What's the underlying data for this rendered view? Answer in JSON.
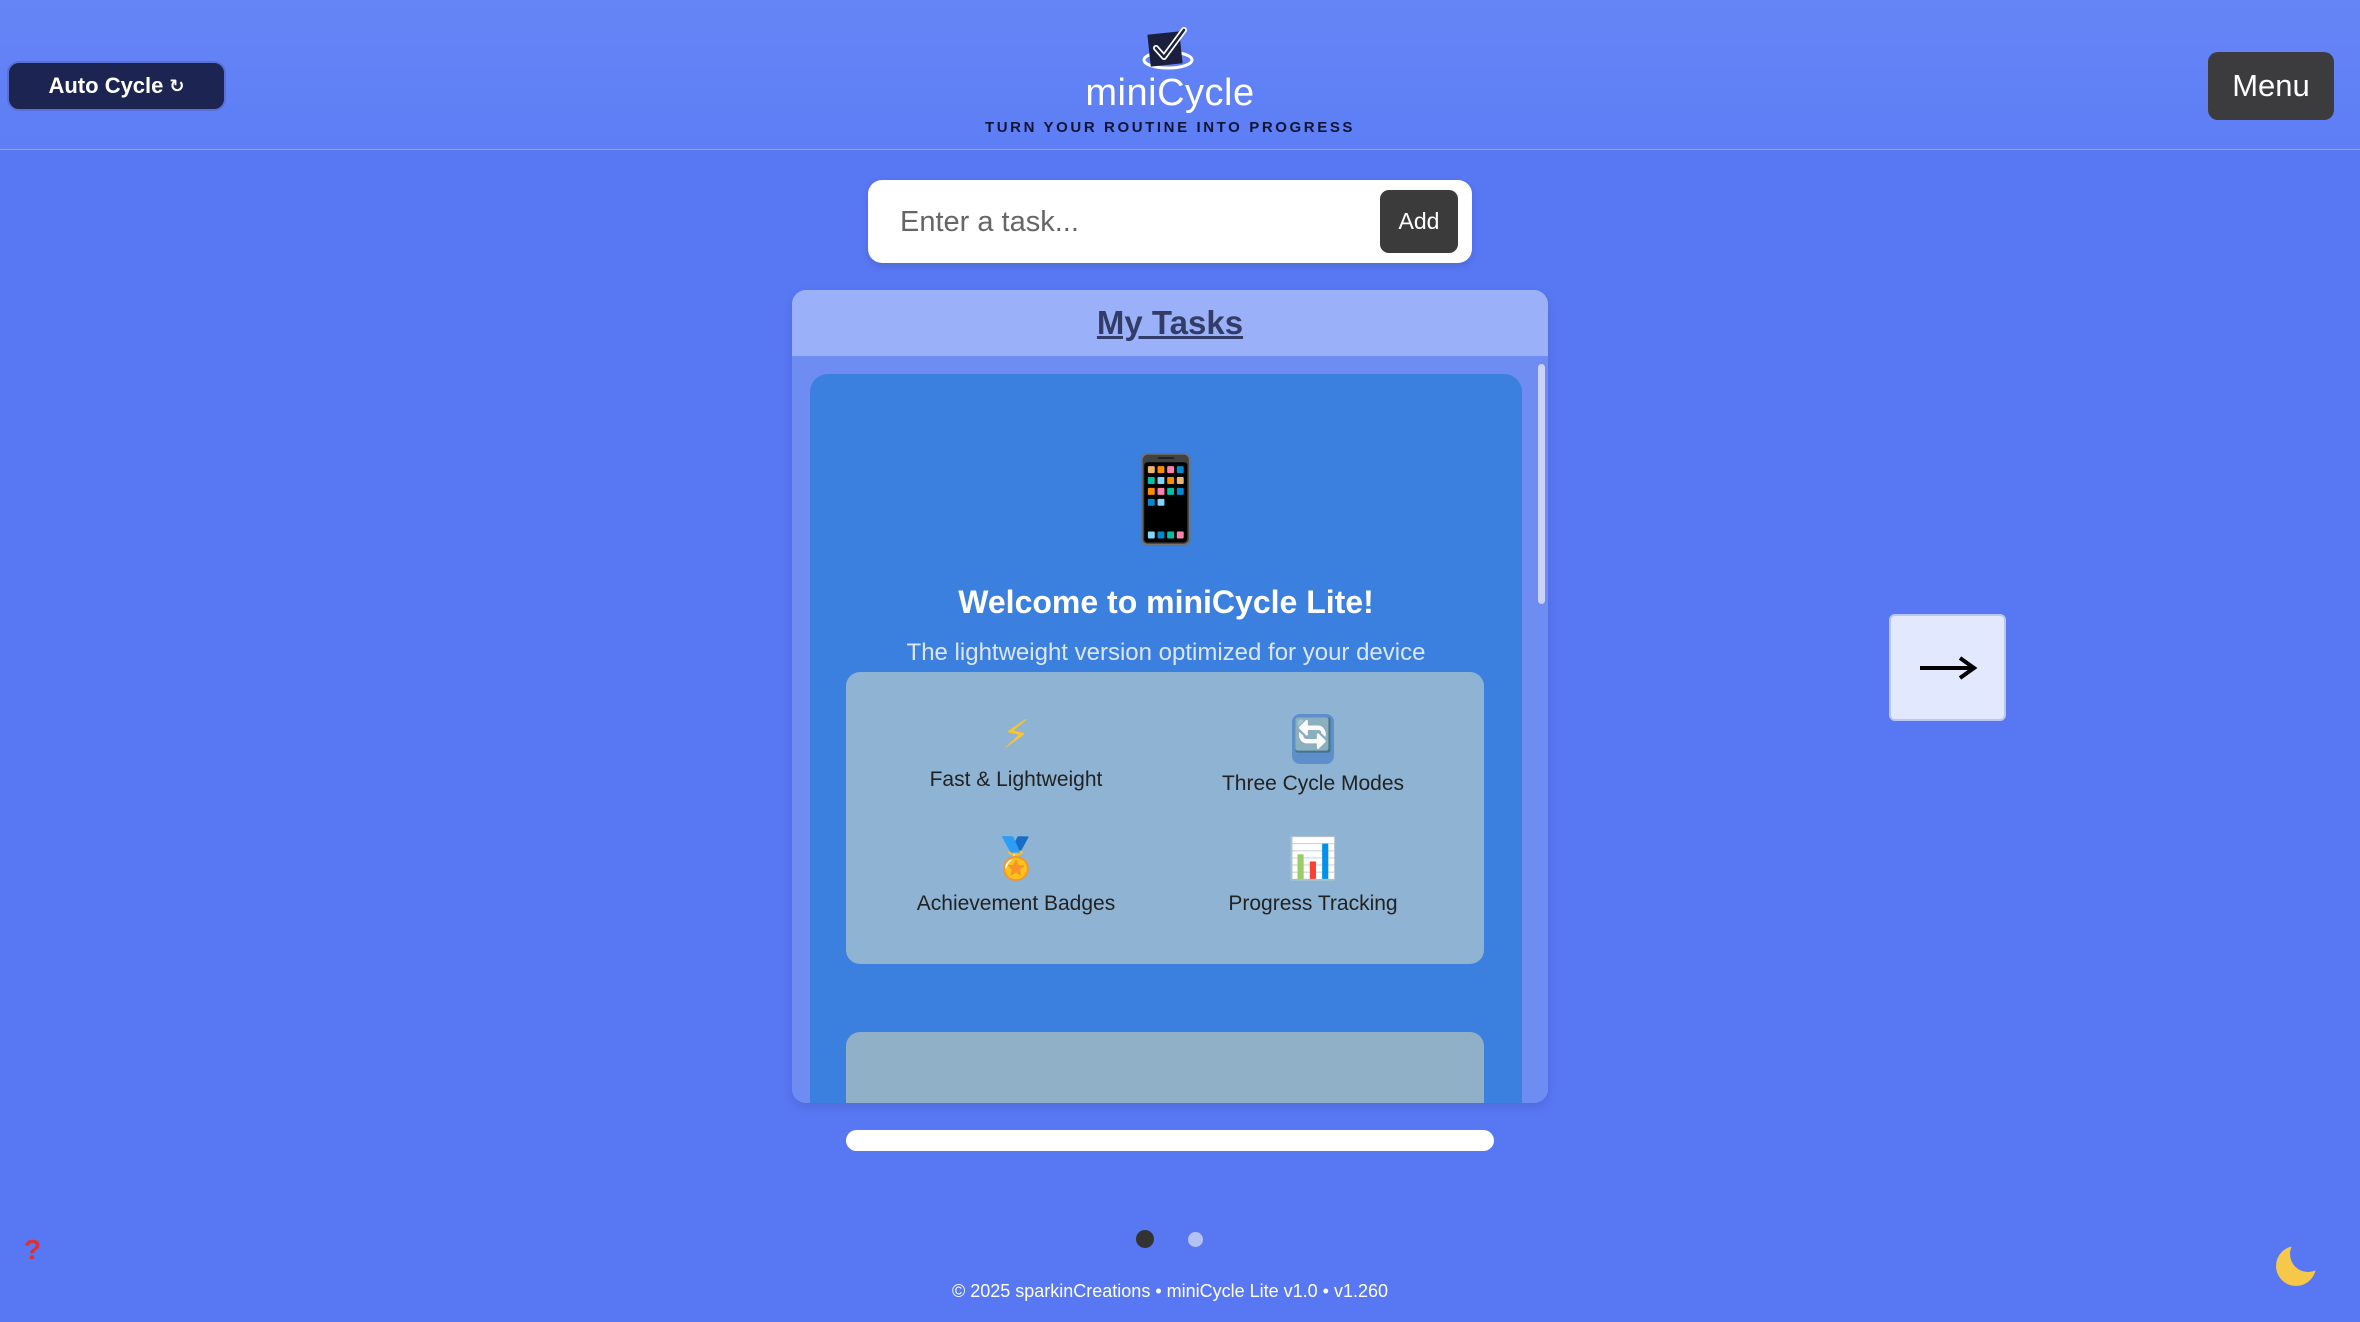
{
  "header": {
    "auto_cycle_label": "Auto Cycle",
    "auto_cycle_icon": "↻",
    "app_name": "miniCycle",
    "tagline": "TURN YOUR ROUTINE INTO PROGRESS",
    "menu_label": "Menu"
  },
  "task_entry": {
    "placeholder": "Enter a task...",
    "value": "",
    "add_label": "Add"
  },
  "tasks_panel": {
    "title": "My Tasks",
    "welcome": {
      "icon": "📱",
      "title": "Welcome to miniCycle Lite!",
      "subtitle": "The lightweight version optimized for your device",
      "features": [
        {
          "icon": "⚡",
          "icon_name": "lightning-icon",
          "label": "Fast & Lightweight"
        },
        {
          "icon": "🔄",
          "icon_name": "cycle-arrows-icon",
          "label": "Three Cycle Modes"
        },
        {
          "icon": "🏅",
          "icon_name": "medal-icon",
          "label": "Achievement Badges"
        },
        {
          "icon": "📊",
          "icon_name": "bar-chart-icon",
          "label": "Progress Tracking"
        }
      ]
    }
  },
  "progress": {
    "percent": 0
  },
  "navigation": {
    "next_arrow": "→",
    "pages": 2,
    "active_page": 1
  },
  "help_icon": "?",
  "theme_icon": "moon-icon",
  "footer": {
    "text": "© 2025 sparkinCreations • miniCycle Lite v1.0 • v1.260"
  },
  "colors": {
    "background": "#5877f3",
    "card": "#3b7fdf",
    "button_dark": "#3b3b3b",
    "auto_cycle_bg": "#1c2551"
  }
}
